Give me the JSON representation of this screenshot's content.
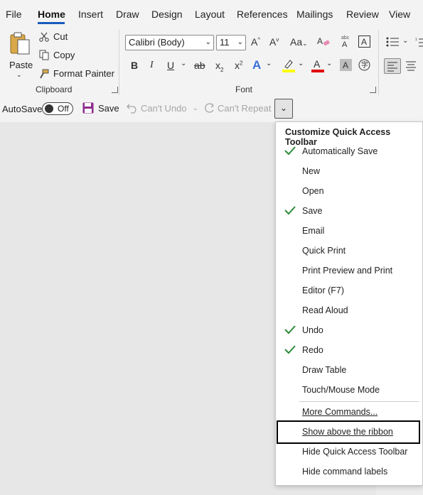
{
  "tabs": [
    "File",
    "Home",
    "Insert",
    "Draw",
    "Design",
    "Layout",
    "References",
    "Mailings",
    "Review",
    "View"
  ],
  "clipboard": {
    "paste_label": "Paste",
    "cut_label": "Cut",
    "copy_label": "Copy",
    "format_painter_label": "Format Painter",
    "group_label": "Clipboard"
  },
  "font": {
    "font_name": "Calibri (Body)",
    "font_size": "11",
    "group_label": "Font",
    "highlight_color": "#ffff00",
    "font_color": "#e00000"
  },
  "qat": {
    "autosave_label": "AutoSave",
    "autosave_state": "Off",
    "save_label": "Save",
    "undo_label": "Can't Undo",
    "repeat_label": "Can't Repeat"
  },
  "menu": {
    "title": "Customize Quick Access Toolbar",
    "items": [
      {
        "label": "Automatically Save",
        "checked": true
      },
      {
        "label": "New",
        "checked": false
      },
      {
        "label": "Open",
        "checked": false
      },
      {
        "label": "Save",
        "checked": true
      },
      {
        "label": "Email",
        "checked": false
      },
      {
        "label": "Quick Print",
        "checked": false
      },
      {
        "label": "Print Preview and Print",
        "checked": false
      },
      {
        "label": "Editor (F7)",
        "checked": false
      },
      {
        "label": "Read Aloud",
        "checked": false
      },
      {
        "label": "Undo",
        "checked": true
      },
      {
        "label": "Redo",
        "checked": true
      },
      {
        "label": "Draw Table",
        "checked": false
      },
      {
        "label": "Touch/Mouse Mode",
        "checked": false
      }
    ],
    "more_commands": "More Commands...",
    "show_above": "Show above the ribbon",
    "hide_qat": "Hide Quick Access Toolbar",
    "hide_labels": "Hide command labels"
  },
  "colors": {
    "accent": "#185abd",
    "check": "#2e8b3a"
  }
}
